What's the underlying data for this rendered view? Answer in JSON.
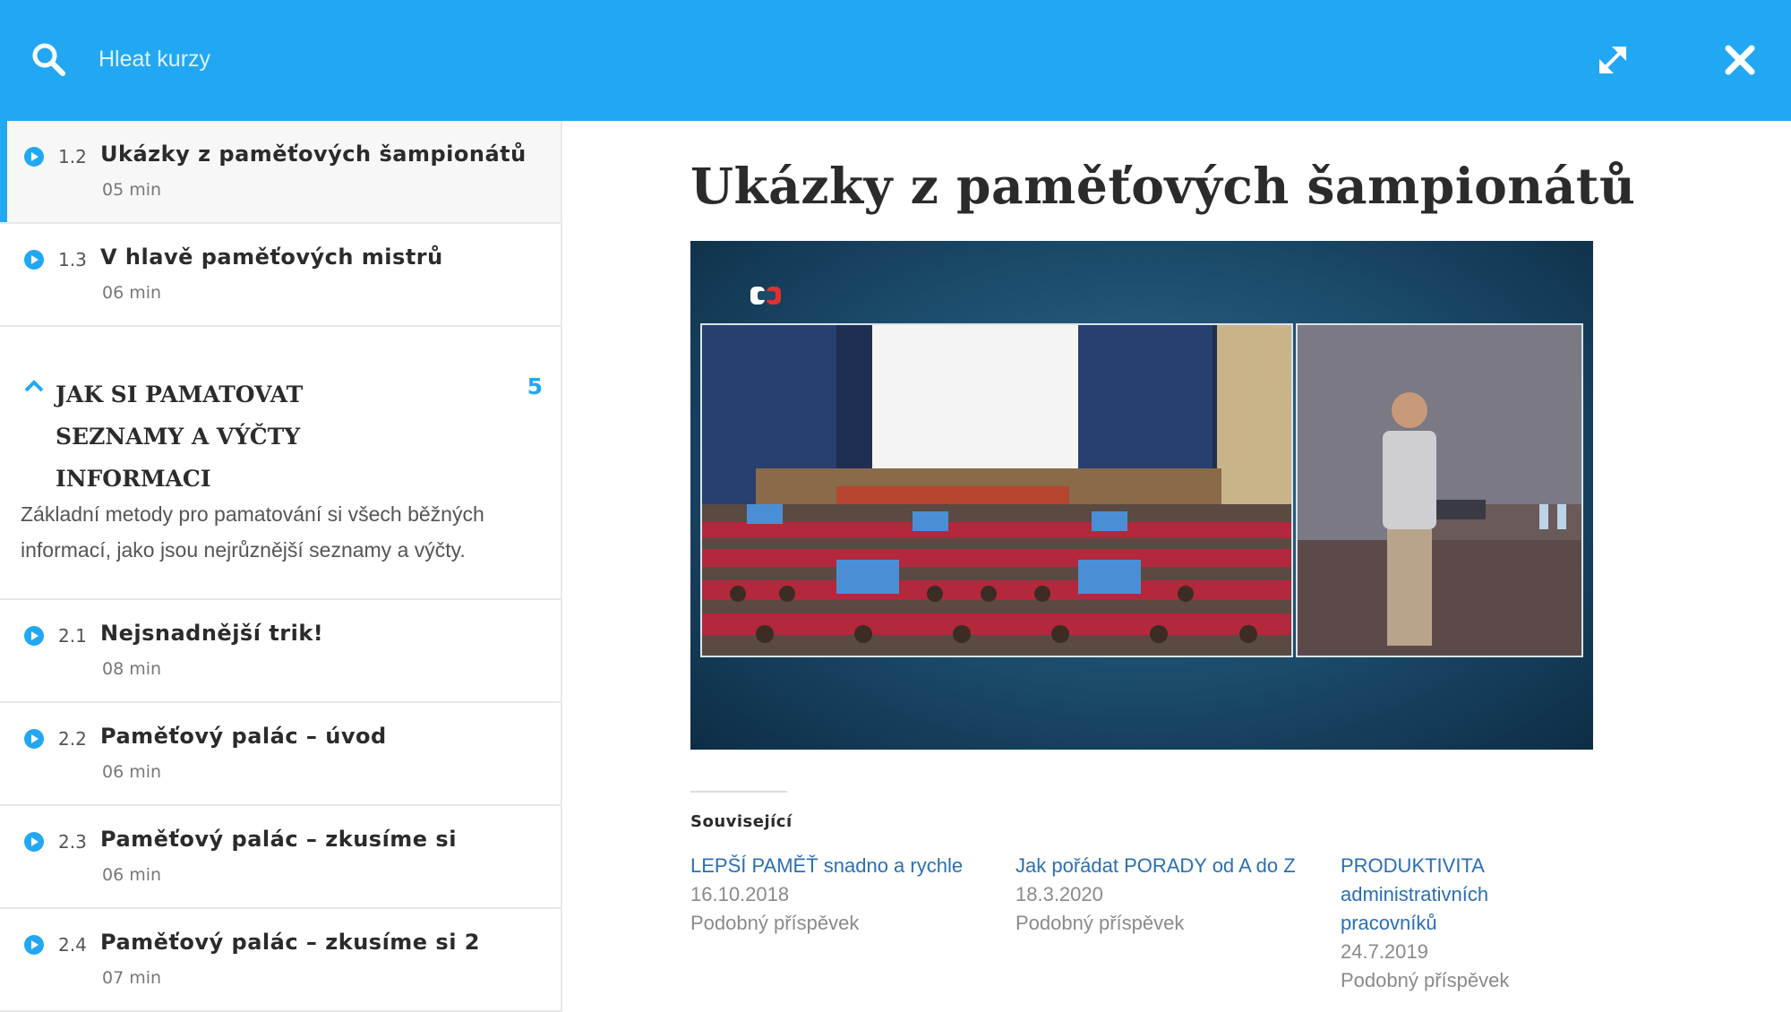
{
  "search": {
    "placeholder": "Hleat kurzy"
  },
  "icons": {
    "search": "search-icon",
    "expand": "expand-icon",
    "close": "close-icon",
    "play": "play-circle-icon",
    "chevron": "chevron-up-icon"
  },
  "colors": {
    "accent": "#22a8f2",
    "link": "#2a6fb5",
    "text": "#2b2b2b",
    "muted": "#8a8a8a"
  },
  "sidebar": {
    "lessons_top": [
      {
        "num": "1.2",
        "title": "Ukázky z paměťových šampionátů",
        "duration": "05 min",
        "active": true
      },
      {
        "num": "1.3",
        "title": "V hlavě paměťových mistrů",
        "duration": "06 min",
        "active": false
      }
    ],
    "chapter": {
      "title_line1": "JAK SI PAMATOVAT",
      "title_line2": "SEZNAMY A VÝČTY",
      "title_line3": "INFORMACI",
      "count": "5",
      "description": "Základní metody pro pamatování si všech běžných informací, jako jsou nejrůznější seznamy a výčty."
    },
    "lessons_bottom": [
      {
        "num": "2.1",
        "title": "Nejsnadnější trik!",
        "duration": "08 min"
      },
      {
        "num": "2.2",
        "title": "Paměťový palác – úvod",
        "duration": "06 min"
      },
      {
        "num": "2.3",
        "title": "Paměťový palác – zkusíme si",
        "duration": "06 min"
      },
      {
        "num": "2.4",
        "title": "Paměťový palác – zkusíme si 2",
        "duration": "07 min"
      }
    ]
  },
  "main": {
    "title": "Ukázky z paměťových šampionátů",
    "related_label": "Související",
    "related": [
      {
        "title": "LEPŠÍ PAMĚŤ snadno a rychle",
        "title2": "",
        "date": "16.10.2018",
        "type": "Podobný příspěvek"
      },
      {
        "title": "Jak pořádat PORADY od A do Z",
        "title2": "",
        "date": "18.3.2020",
        "type": "Podobný příspěvek"
      },
      {
        "title": "PRODUKTIVITA administrativních",
        "title2": "pracovníků",
        "date": "24.7.2019",
        "type": "Podobný příspěvek"
      }
    ]
  }
}
